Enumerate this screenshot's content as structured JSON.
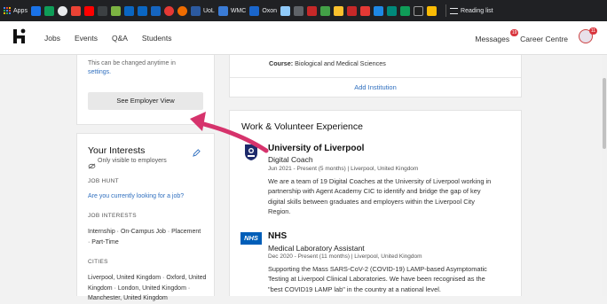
{
  "browser": {
    "apps_label": "Apps",
    "bookmarks": [
      {
        "label": "UoL",
        "color": "#2c5aa0"
      },
      {
        "label": "WMC",
        "color": "#3a7bd5"
      },
      {
        "label": "Oxon",
        "color": "#1a66cc"
      }
    ],
    "reading_list": "Reading list"
  },
  "nav": {
    "links": [
      "Jobs",
      "Events",
      "Q&A",
      "Students"
    ],
    "messages": "Messages",
    "messages_count": "19",
    "career_centre": "Career Centre",
    "avatar_count": "11"
  },
  "left_top": {
    "note_line1": "This can be changed anytime in",
    "note_link": "settings.",
    "button": "See Employer View"
  },
  "interests": {
    "title": "Your Interests",
    "visibility": "Only visible to employers",
    "job_hunt_header": "JOB HUNT",
    "job_hunt_link": "Are you currently looking for a job?",
    "job_interests_header": "JOB INTERESTS",
    "job_interests_text": "Internship · On-Campus Job · Placement · Part-Time",
    "cities_header": "CITIES",
    "cities_text": "Liverpool, United Kingdom · Oxford, United Kingdom · London, United Kingdom · Manchester, United Kingdom"
  },
  "education": {
    "course_label": "Course:",
    "course_value": "Biological and Medical Sciences",
    "add_link": "Add Institution"
  },
  "experience": {
    "section_title": "Work & Volunteer Experience",
    "entries": [
      {
        "org": "University of Liverpool",
        "role": "Digital Coach",
        "meta": "Jun 2021 - Present (5 months) | Liverpool, United Kingdom",
        "desc": [
          "We are a team of 19 Digital Coaches at the University of Liverpool working in",
          "partnership with Agent Academy CIC to identify and bridge the gap of key",
          "digital skills between graduates and employers within the Liverpool City",
          "Region."
        ]
      },
      {
        "org": "NHS",
        "role": "Medical Laboratory Assistant",
        "meta": "Dec 2020 - Present (11 months) | Liverpool, United Kingdom",
        "desc": [
          "Supporting the Mass SARS-CoV-2 (COVID-19) LAMP-based Asymptomatic",
          "Testing at Liverpool Clinical Laboratories. We have been recognised as the",
          "\"best COVID19 LAMP lab\" in the country at a national level."
        ]
      }
    ]
  },
  "colors": {
    "accent": "#2f6fbf",
    "arrow": "#d6336c",
    "badge": "#d9363e"
  }
}
